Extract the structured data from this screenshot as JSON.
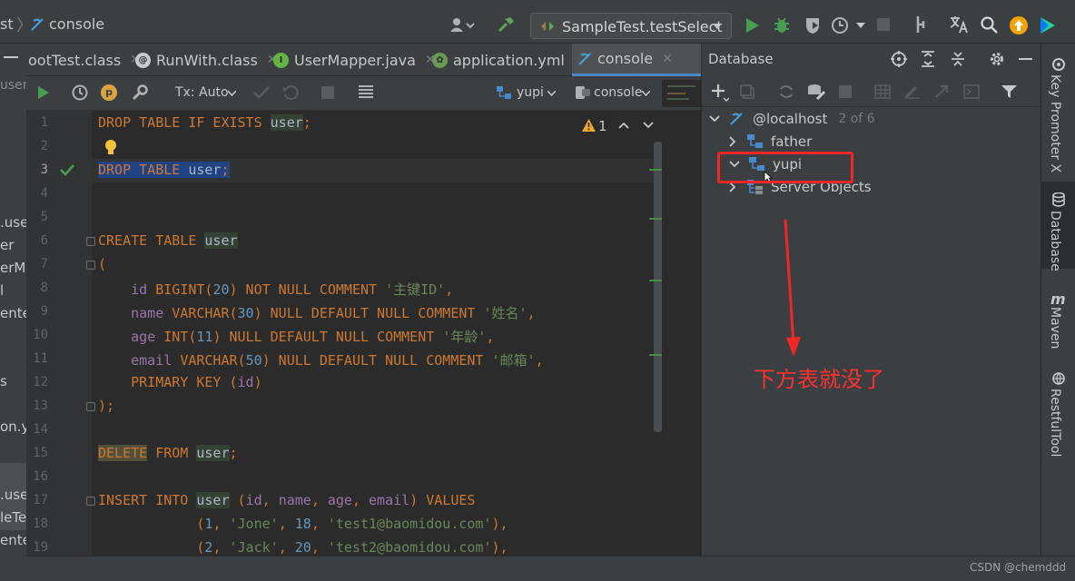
{
  "navbar": {
    "crumb_partial": "st",
    "crumb_file": "console",
    "run_config": "SampleTest.testSelect"
  },
  "left_fragments": [
    "user-",
    ".use",
    "er",
    "erM",
    "l",
    "ente",
    "s",
    "on.y",
    ".use",
    "leTe",
    "ente"
  ],
  "tabs": [
    {
      "label": "ootTest.class"
    },
    {
      "label": "RunWith.class"
    },
    {
      "label": "UserMapper.java"
    },
    {
      "label": "application.yml"
    },
    {
      "label": "console"
    }
  ],
  "console_toolbar": {
    "tx_mode": "Tx: Auto",
    "schema": "yupi",
    "session": "console"
  },
  "editor": {
    "line_numbers": [
      "1",
      "2",
      "3",
      "4",
      "5",
      "6",
      "7",
      "8",
      "9",
      "10",
      "11",
      "12",
      "13",
      "14",
      "15",
      "16",
      "17",
      "18",
      "19"
    ],
    "warning_count": "1",
    "lines": {
      "l1": [
        "DROP TABLE IF EXISTS",
        "user",
        ";"
      ],
      "l3": [
        "DROP TABLE",
        "user",
        ";"
      ],
      "l6": [
        "CREATE TABLE",
        "user"
      ],
      "l7": "(",
      "l8": [
        "id",
        "BIGINT(",
        "20",
        ") NOT NULL COMMENT",
        "'主键ID'",
        ","
      ],
      "l9": [
        "name",
        "VARCHAR(",
        "30",
        ") NULL DEFAULT NULL COMMENT",
        "'姓名'",
        ","
      ],
      "l10": [
        "age",
        "INT(",
        "11",
        ") NULL DEFAULT NULL COMMENT",
        "'年龄'",
        ","
      ],
      "l11": [
        "email",
        "VARCHAR(",
        "50",
        ") NULL DEFAULT NULL COMMENT",
        "'邮箱'",
        ","
      ],
      "l12": [
        "PRIMARY KEY",
        "(",
        "id",
        ")"
      ],
      "l13": ");",
      "l15": [
        "DELETE",
        "FROM",
        "user",
        ";"
      ],
      "l17": [
        "INSERT INTO",
        "user",
        "(",
        "id",
        ",",
        "name",
        ",",
        "age",
        ",",
        "email",
        ")",
        "VALUES"
      ],
      "l18": [
        "(",
        "1",
        ",",
        "'Jone'",
        ",",
        "18",
        ",",
        "'test1@baomidou.com'",
        "),"
      ],
      "l19": [
        "(",
        "2",
        ",",
        "'Jack'",
        ",",
        "20",
        ",",
        "'test2@baomidou.com'",
        "),"
      ]
    }
  },
  "database_panel": {
    "title": "Database",
    "host": "@localhost",
    "host_count": "2 of 6",
    "items": [
      {
        "label": "father",
        "expanded": false
      },
      {
        "label": "yupi",
        "expanded": true
      },
      {
        "label": "Server Objects",
        "expanded": false
      }
    ]
  },
  "right_tabs": [
    "Key Promoter X",
    "Database",
    "Maven",
    "RestfulTool"
  ],
  "annotation": "下方表就没了",
  "watermark": "CSDN @chemddd",
  "colors": {
    "keyword": "#cc7832",
    "string": "#6a8759",
    "number": "#6897bb",
    "annotation": "#f02727",
    "selection": "#214283"
  }
}
